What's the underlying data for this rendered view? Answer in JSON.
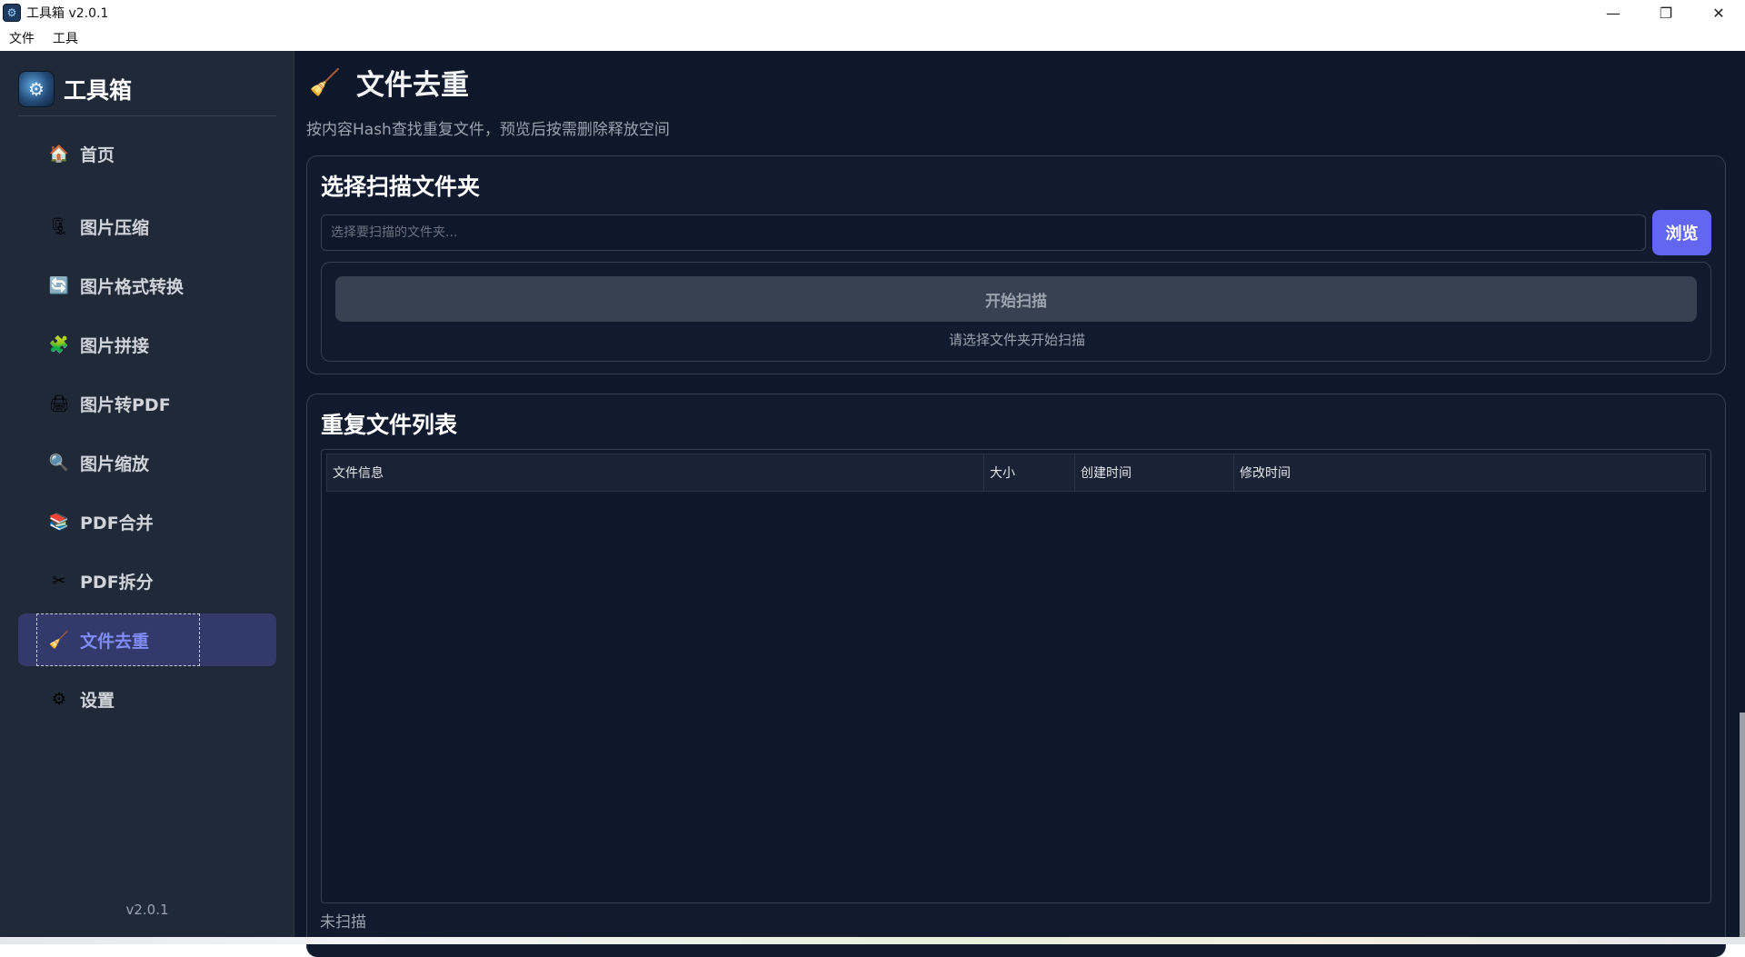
{
  "window": {
    "title": "工具箱 v2.0.1",
    "minimize": "—",
    "maximize": "❐",
    "close": "✕"
  },
  "menu": [
    "文件",
    "工具"
  ],
  "sidebar": {
    "brand": "工具箱",
    "items": [
      {
        "label": "首页",
        "icon": "home-icon",
        "glyph": "🏠"
      },
      {
        "label": "图片压缩",
        "icon": "clamp-icon",
        "glyph": "🗜"
      },
      {
        "label": "图片格式转换",
        "icon": "convert-icon",
        "glyph": "🔄"
      },
      {
        "label": "图片拼接",
        "icon": "puzzle-icon",
        "glyph": "🧩"
      },
      {
        "label": "图片转PDF",
        "icon": "printer-icon",
        "glyph": "🖨"
      },
      {
        "label": "图片缩放",
        "icon": "magnifier-icon",
        "glyph": "🔍"
      },
      {
        "label": "PDF合并",
        "icon": "books-icon",
        "glyph": "📚"
      },
      {
        "label": "PDF拆分",
        "icon": "scissors-icon",
        "glyph": "✂"
      },
      {
        "label": "文件去重",
        "icon": "broom-icon",
        "glyph": "🧹"
      },
      {
        "label": "设置",
        "icon": "gear-icon",
        "glyph": "⚙"
      }
    ],
    "active_index": 8,
    "version": "v2.0.1"
  },
  "page": {
    "title": "文件去重",
    "title_glyph": "🧹",
    "subtitle": "按内容Hash查找重复文件，预览后按需删除释放空间"
  },
  "scan_card": {
    "title": "选择扫描文件夹",
    "input_value": "",
    "input_placeholder": "选择要扫描的文件夹...",
    "browse_label": "浏览",
    "scan_button": "开始扫描",
    "hint": "请选择文件夹开始扫描"
  },
  "list_card": {
    "title": "重复文件列表",
    "columns": [
      "文件信息",
      "大小",
      "创建时间",
      "修改时间"
    ],
    "rows": []
  },
  "status": "未扫描",
  "colors": {
    "background": "#0f172a",
    "sidebar": "#1f2937",
    "accent": "#6366f1",
    "active_nav": "#323a6b"
  }
}
